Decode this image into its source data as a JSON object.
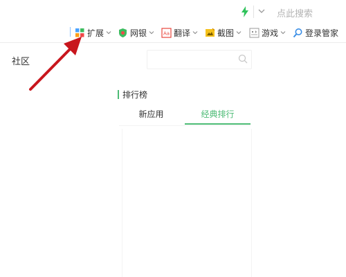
{
  "topbar": {
    "search_hint": "点此搜索"
  },
  "toolbar": {
    "items": [
      {
        "label": "扩展",
        "icon": "extensions-icon"
      },
      {
        "label": "网银",
        "icon": "bank-shield-icon"
      },
      {
        "label": "翻译",
        "icon": "translate-icon"
      },
      {
        "label": "截图",
        "icon": "screenshot-icon"
      },
      {
        "label": "游戏",
        "icon": "game-icon"
      },
      {
        "label": "登录管家",
        "icon": "login-manager-icon"
      }
    ]
  },
  "main": {
    "community_label": "社区",
    "ranking_title": "排行榜",
    "tabs": [
      {
        "label": "新应用",
        "active": false
      },
      {
        "label": "经典排行",
        "active": true
      }
    ]
  },
  "colors": {
    "accent_green": "#4cbb75",
    "annotation_arrow": "#c8161d"
  }
}
